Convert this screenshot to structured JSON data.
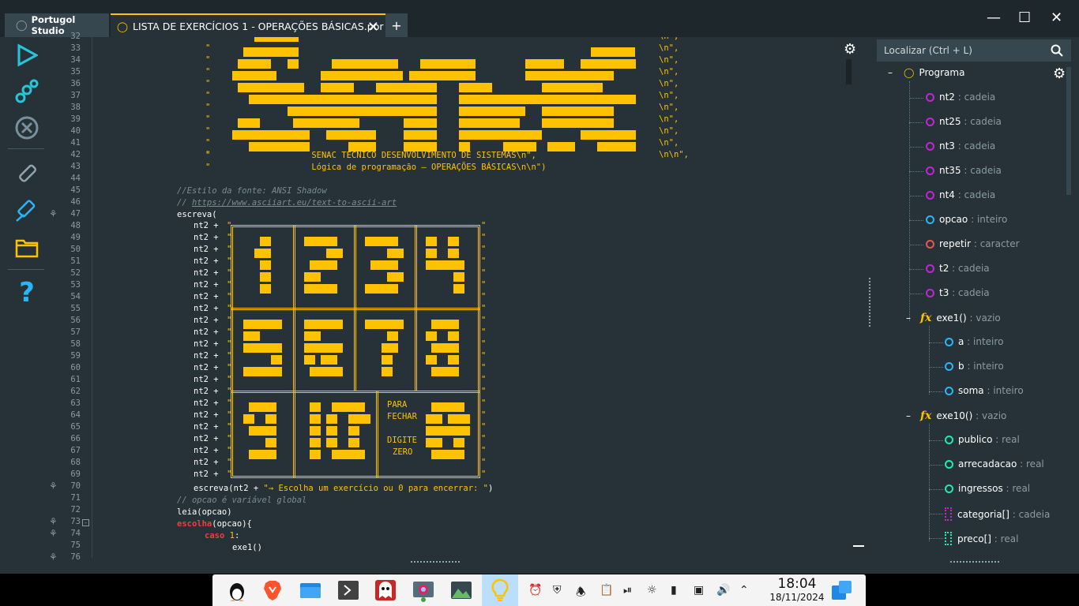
{
  "tabs": {
    "home": "Portugol Studio",
    "file": "LISTA DE EXERCÍCIOS 1 - OPERAÇÕES BÁSICAS.por",
    "add": "+"
  },
  "window_controls": {
    "minimize": "—",
    "maximize": "☐",
    "close": "✕"
  },
  "toolbar_icons": [
    "run-icon",
    "step-icon",
    "stop-icon",
    "brush-icon",
    "usb-icon",
    "folder-icon",
    "help-icon"
  ],
  "editor": {
    "line_numbers": [
      "32",
      "33",
      "34",
      "35",
      "36",
      "37",
      "38",
      "39",
      "40",
      "41",
      "42",
      "43",
      "44",
      "45",
      "46",
      "47",
      "48",
      "49",
      "50",
      "51",
      "52",
      "53",
      "54",
      "55",
      "56",
      "57",
      "58",
      "59",
      "60",
      "61",
      "62",
      "63",
      "64",
      "65",
      "66",
      "67",
      "68",
      "69",
      "70",
      "71",
      "72",
      "73",
      "74",
      "75",
      "76"
    ],
    "banner_quotes": "\"",
    "banner_ends": [
      "\\n\",",
      "\\n\",",
      "\\n\",",
      "\\n\",",
      "\\n\",",
      "\\n\",",
      "\\n\",",
      "\\n\",",
      "\\n\",",
      "\\n\\n\","
    ],
    "line42": "SENAC TÉCNICO DESENVOLVIMENTO DE SISTEMAS\\n\",",
    "line43": "Lógica de programação – OPERAÇÕES BÁSICAS\\n\\n\")",
    "comment45": "//Estilo da fonte: ANSI Shadow",
    "comment46_prefix": "// ",
    "comment46_link": "https://www.asciiart.eu/text-to-ascii-art",
    "line47": "escreva(",
    "nt2_prefix": "nt2 + ",
    "menu_para": "PARA",
    "menu_fechar": "FECHAR",
    "menu_digite": "DIGITE",
    "menu_zero": "ZERO",
    "line70_pre": "escreva(nt2 + ",
    "line70_str": "\"→ Escolha um exercício ou 0 para encerrar: \"",
    "line70_post": ")",
    "comment71": "// opcao é variável global",
    "line72": "leia(opcao)",
    "line73_kw": "escolha",
    "line73_rest": "(opcao){",
    "line74_kw": "caso",
    "line74_num": " 1",
    "line74_rest": ":",
    "line75": "exe1()"
  },
  "outline": {
    "search_placeholder": "Localizar (Ctrl + L)",
    "root": "Programa",
    "items": [
      {
        "name": "nt2",
        "type": "cadeia",
        "color": "#c026d3"
      },
      {
        "name": "nt25",
        "type": "cadeia",
        "color": "#c026d3"
      },
      {
        "name": "nt3",
        "type": "cadeia",
        "color": "#c026d3"
      },
      {
        "name": "nt35",
        "type": "cadeia",
        "color": "#c026d3"
      },
      {
        "name": "nt4",
        "type": "cadeia",
        "color": "#c026d3"
      },
      {
        "name": "opcao",
        "type": "inteiro",
        "color": "#29b6f6"
      },
      {
        "name": "repetir",
        "type": "caracter",
        "color": "#ef5350"
      },
      {
        "name": "t2",
        "type": "cadeia",
        "color": "#c026d3"
      },
      {
        "name": "t3",
        "type": "cadeia",
        "color": "#c026d3"
      }
    ],
    "func1": {
      "name": "exe1()",
      "type": "vazio",
      "params": [
        {
          "name": "a",
          "type": "inteiro",
          "color": "#29b6f6"
        },
        {
          "name": "b",
          "type": "inteiro",
          "color": "#29b6f6"
        },
        {
          "name": "soma",
          "type": "inteiro",
          "color": "#29b6f6"
        }
      ]
    },
    "func2": {
      "name": "exe10()",
      "type": "vazio",
      "params": [
        {
          "name": "publico",
          "type": "real",
          "color": "#1de9b6"
        },
        {
          "name": "arrecadacao",
          "type": "real",
          "color": "#1de9b6"
        },
        {
          "name": "ingressos",
          "type": "real",
          "color": "#1de9b6"
        },
        {
          "name": "categoria[]",
          "type": "cadeia",
          "color": "#c026d3"
        },
        {
          "name": "preco[]",
          "type": "real",
          "color": "#1de9b6"
        }
      ]
    },
    "sep": " : "
  },
  "taskbar": {
    "time": "18:04",
    "date": "18/11/2024"
  }
}
